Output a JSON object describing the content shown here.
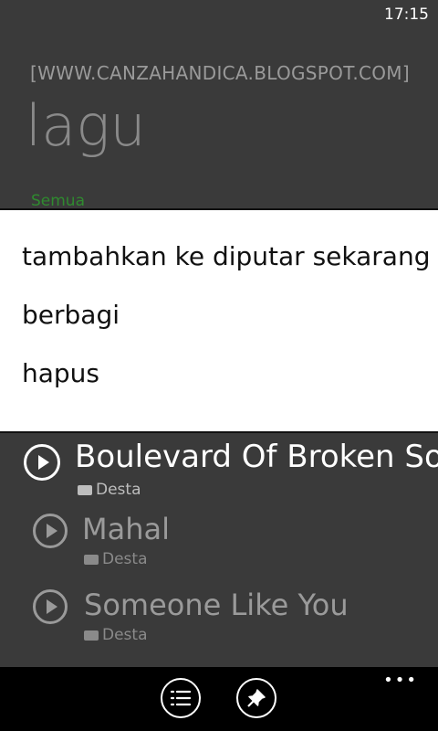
{
  "status": {
    "time": "17:15"
  },
  "header": {
    "blog": "[WWW.CANZAHANDICA.BLOGSPOT.COM]",
    "title": "lagu",
    "pivot": "Semua"
  },
  "context_menu": {
    "items": [
      {
        "label": "tambahkan ke diputar sekarang"
      },
      {
        "label": "berbagi"
      },
      {
        "label": "hapus"
      }
    ]
  },
  "songs": [
    {
      "title": "Boulevard Of Broken Son",
      "artist": "Desta"
    },
    {
      "title": "Mahal",
      "artist": "Desta"
    },
    {
      "title": "Someone Like You",
      "artist": "Desta"
    }
  ],
  "appbar": {
    "more": "•••"
  },
  "colors": {
    "accent": "#2f8a2f",
    "menu_bg": "#ffffff",
    "appbar_bg": "#000000"
  }
}
